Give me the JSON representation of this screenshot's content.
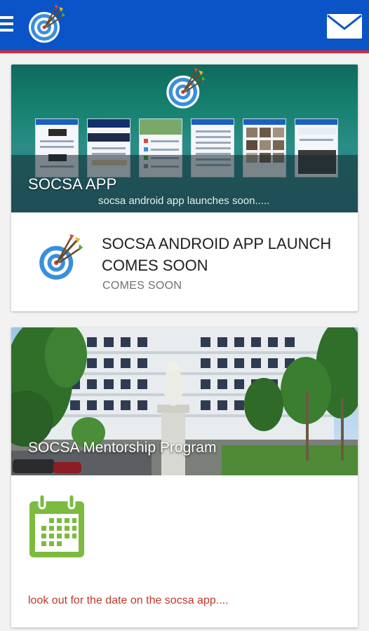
{
  "appbar": {
    "menu_icon": "hamburger-menu-icon",
    "logo_icon": "socsa-target-logo-icon",
    "mail_icon": "envelope-icon",
    "colors": {
      "bar": "#0a54c7",
      "underline": "#e02730"
    }
  },
  "cards": [
    {
      "banner_title": "SOCSA APP",
      "banner_subtitle": "socsa android app launches soon.....",
      "headline": "SOCSA ANDROID APP LAUNCH COMES SOON",
      "subhead": "COMES SOON",
      "icon": "socsa-target-logo-icon"
    },
    {
      "banner_title": "SOCSA Mentorship Program",
      "icon": "calendar-icon",
      "note": "look out for the date on the socsa app...."
    }
  ]
}
